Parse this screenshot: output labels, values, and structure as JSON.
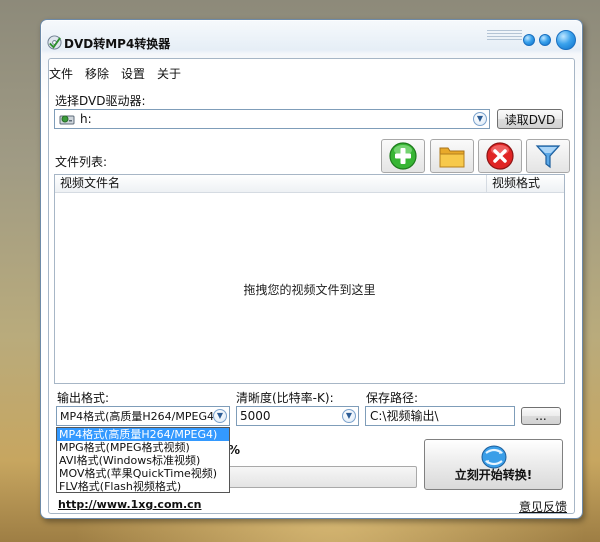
{
  "window": {
    "title": "DVD转MP4转换器"
  },
  "menu": [
    "文件",
    "移除",
    "设置",
    "关于"
  ],
  "drive": {
    "label": "选择DVD驱动器:",
    "value": "h:",
    "read_button": "读取DVD"
  },
  "files": {
    "label": "文件列表:",
    "columns": [
      "视频文件名",
      "视频格式"
    ],
    "drop_hint": "拖拽您的视频文件到这里"
  },
  "output": {
    "format_label": "输出格式:",
    "format_value": "MP4格式(高质量H264/MPEG4)",
    "format_options": [
      "MP4格式(高质量H264/MPEG4)",
      "MPG格式(MPEG格式视频)",
      "AVI格式(Windows标准视频)",
      "MOV格式(苹果QuickTime视频)",
      "FLV格式(Flash视频格式)"
    ],
    "bitrate_label": "清晰度(比特率-K):",
    "bitrate_value": "5000",
    "path_label": "保存路径:",
    "path_value": "C:\\视频输出\\",
    "browse_label": "..."
  },
  "progress": {
    "text": "%",
    "fraction": 0
  },
  "start_button": "立刻开始转换!",
  "footer": {
    "url": "http://www.1xg.com.cn",
    "feedback": "意见反馈"
  },
  "colors": {
    "accent": "#3399ff",
    "window_border": "#6d8aa8"
  },
  "icons": [
    "app-disc-icon",
    "drive-icon",
    "add-file-icon",
    "open-folder-icon",
    "remove-icon",
    "filter-icon",
    "convert-icon"
  ]
}
